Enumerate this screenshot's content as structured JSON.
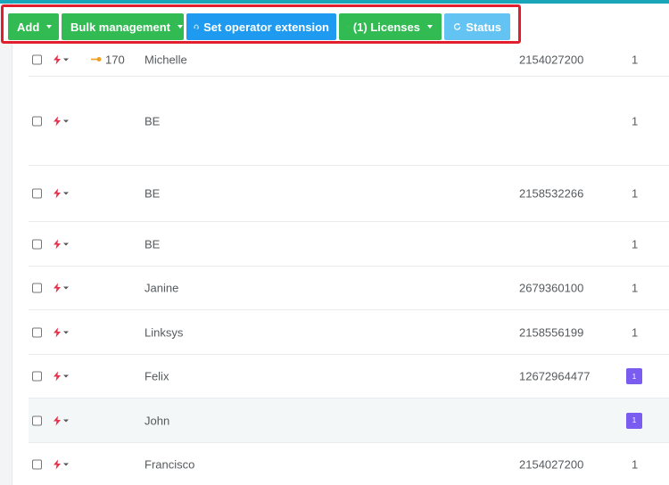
{
  "toolbar": {
    "add_label": "Add",
    "bulk_label": "Bulk management",
    "operator_label": "Set operator extension",
    "licenses_label": "(1) Licenses",
    "status_label": "Status"
  },
  "rows": [
    {
      "extension": "170",
      "name": "Michelle",
      "phone": "2154027200",
      "count": "1"
    },
    {
      "extension": "",
      "name": "BE",
      "phone": "",
      "count": "1"
    },
    {
      "extension": "",
      "name": "BE",
      "phone": "2158532266",
      "count": "1"
    },
    {
      "extension": "",
      "name": "BE",
      "phone": "",
      "count": "1"
    },
    {
      "extension": "",
      "name": "Janine",
      "phone": "2679360100",
      "count": "1"
    },
    {
      "extension": "",
      "name": "Linksys",
      "phone": "2158556199",
      "count": "1"
    },
    {
      "extension": "",
      "name": "Felix",
      "phone": "12672964477",
      "count": "1"
    },
    {
      "extension": "",
      "name": "John",
      "phone": "",
      "count": "1"
    },
    {
      "extension": "",
      "name": "Francisco",
      "phone": "2154027200",
      "count": "1"
    }
  ],
  "colors": {
    "highlight": "#e21d2e",
    "green": "#32bb53",
    "blue": "#1e9bf0",
    "badge": "#7a5cf0"
  },
  "icons": {
    "action": "bolt-icon",
    "operator": "headset-icon",
    "licenses": "key-icon",
    "status": "refresh-icon"
  }
}
